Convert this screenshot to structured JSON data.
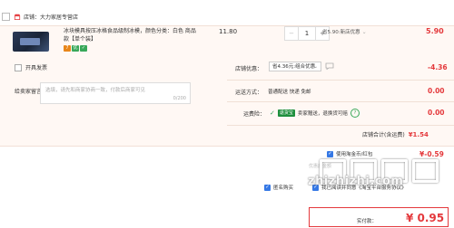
{
  "shop": {
    "name": "店铺：大力家居专营店"
  },
  "product": {
    "title": "冰块模具按压冰格食品级制冰模，颜色分类：白色 商品款【单个装】",
    "badges": [
      "7",
      "优",
      "✓"
    ],
    "unit_price": "11.80",
    "quantity": "1",
    "minus_label": "−",
    "plus_label": "+",
    "promo_label": "省5.90:新店优惠",
    "promo_chevron": "⌄",
    "subtotal": "5.90"
  },
  "invoice": {
    "label": "开具发票"
  },
  "message": {
    "label": "给卖家留言：",
    "placeholder": "选填，请先和商家协商一致，付款后商家可见",
    "count": "0/200"
  },
  "coupon": {
    "label": "店铺优惠：",
    "selected": "省4.36元:组合优惠",
    "arrow": "⌄",
    "value": "-4.36"
  },
  "shipping": {
    "label": "运送方式：",
    "method": "普通配送 快递 免邮",
    "value": "0.00"
  },
  "insurance": {
    "label": "运费险：",
    "badge": "退货宝",
    "text": "卖家赠送，退换货可赔",
    "help": "?",
    "value": "0.00"
  },
  "store_total": {
    "label": "店铺合计(含运费)",
    "amount": "¥1.54"
  },
  "redbag": {
    "label": "使用淘金币/红包",
    "amount": "¥-0.59",
    "note": "优惠后金额"
  },
  "anonymous": {
    "label": "匿名购买"
  },
  "agreement": {
    "label": "我已阅读并同意《淘宝平台服务协议》"
  },
  "payment": {
    "label": "实付款：",
    "amount": "¥ 0.95"
  },
  "watermark": {
    "text": "zhizhizhi.com"
  },
  "colors": {
    "accent": "#e4393c",
    "panel": "#fff8f4",
    "checkbox": "#3578e5",
    "insurance": "#1e8f3d"
  }
}
